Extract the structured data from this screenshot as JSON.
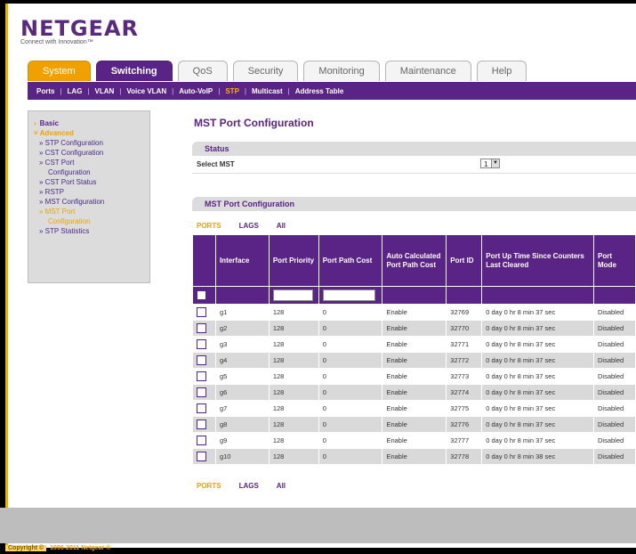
{
  "brand": {
    "name": "NETGEAR",
    "tagline": "Connect with Innovation™"
  },
  "tabs": [
    {
      "label": "System"
    },
    {
      "label": "Switching"
    },
    {
      "label": "QoS"
    },
    {
      "label": "Security"
    },
    {
      "label": "Monitoring"
    },
    {
      "label": "Maintenance"
    },
    {
      "label": "Help"
    }
  ],
  "subnav": [
    "Ports",
    "LAG",
    "VLAN",
    "Voice VLAN",
    "Auto-VoIP",
    "STP",
    "Multicast",
    "Address Table"
  ],
  "sidebar": {
    "basic": "Basic",
    "advanced": "Advanced",
    "items": [
      "» STP Configuration",
      "» CST Configuration",
      "» CST Port",
      "Configuration",
      "» CST Port Status",
      "» RSTP",
      "» MST Configuration",
      "» MST Port",
      "Configuration",
      "» STP Statistics"
    ]
  },
  "page_title": "MST Port Configuration",
  "status": {
    "header": "Status",
    "select_label": "Select MST",
    "select_value": "1"
  },
  "mst": {
    "header": "MST Port Configuration",
    "links": [
      "PORTS",
      "LAGS",
      "All"
    ],
    "columns": [
      "Interface",
      "Port Priority",
      "Port Path Cost",
      "Auto Calculated Port Path Cost",
      "Port ID",
      "Port Up Time Since Counters Last Cleared",
      "Port Mode"
    ],
    "rows": [
      [
        "g1",
        "128",
        "0",
        "Enable",
        "32769",
        "0 day 0 hr 8 min 37 sec",
        "Disabled"
      ],
      [
        "g2",
        "128",
        "0",
        "Enable",
        "32770",
        "0 day 0 hr 8 min 37 sec",
        "Disabled"
      ],
      [
        "g3",
        "128",
        "0",
        "Enable",
        "32771",
        "0 day 0 hr 8 min 37 sec",
        "Disabled"
      ],
      [
        "g4",
        "128",
        "0",
        "Enable",
        "32772",
        "0 day 0 hr 8 min 37 sec",
        "Disabled"
      ],
      [
        "g5",
        "128",
        "0",
        "Enable",
        "32773",
        "0 day 0 hr 8 min 37 sec",
        "Disabled"
      ],
      [
        "g6",
        "128",
        "0",
        "Enable",
        "32774",
        "0 day 0 hr 8 min 37 sec",
        "Disabled"
      ],
      [
        "g7",
        "128",
        "0",
        "Enable",
        "32775",
        "0 day 0 hr 8 min 37 sec",
        "Disabled"
      ],
      [
        "g8",
        "128",
        "0",
        "Enable",
        "32776",
        "0 day 0 hr 8 min 37 sec",
        "Disabled"
      ],
      [
        "g9",
        "128",
        "0",
        "Enable",
        "32777",
        "0 day 0 hr 8 min 37 sec",
        "Disabled"
      ],
      [
        "g10",
        "128",
        "0",
        "Enable",
        "32778",
        "0 day 0 hr 8 min 38 sec",
        "Disabled"
      ]
    ]
  },
  "copyright": {
    "pill": "Copyright ©",
    "text": "1996-2011 Netgear ®"
  },
  "colors": {
    "purple": "#5a2386",
    "orange": "#f0a100",
    "gray": "#dcdcdc"
  }
}
